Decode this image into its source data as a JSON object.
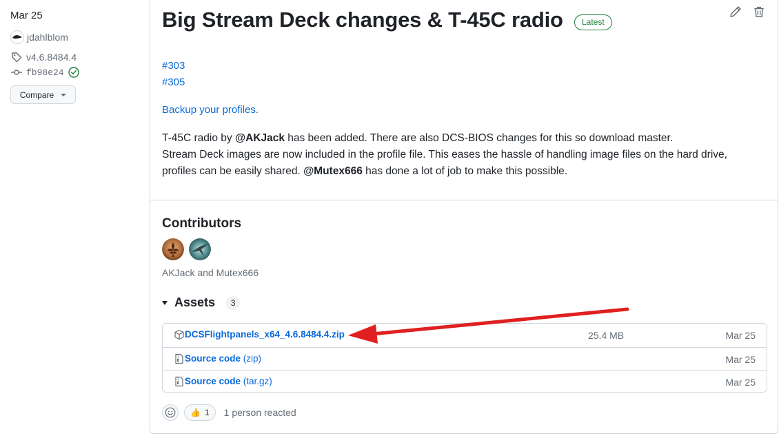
{
  "sidebar": {
    "date": "Mar 25",
    "author": "jdahlblom",
    "tag": "v4.6.8484.4",
    "commit": "fb98e24",
    "compare_label": "Compare"
  },
  "release": {
    "title": "Big Stream Deck changes & T-45C radio",
    "badge": "Latest",
    "issues": [
      "#303",
      "#305"
    ],
    "backup_link": "Backup your profiles.",
    "body": {
      "line1_pre": "T-45C radio by ",
      "line1_mention": "@AKJack",
      "line1_post": " has been added. There are also DCS-BIOS changes for this so download master.",
      "line2": "Stream Deck images are now included in the profile file. This eases the hassle of handling image files on the hard drive,",
      "line3_pre": "profiles can be easily shared. ",
      "line3_mention": "@Mutex666",
      "line3_post": " has done a lot of job to make this possible."
    }
  },
  "contributors": {
    "title": "Contributors",
    "names": "AKJack and Mutex666"
  },
  "assets": {
    "title": "Assets",
    "count": "3",
    "items": [
      {
        "name": "DCSFlightpanels_x64_4.6.8484.4.zip",
        "suffix": "",
        "size": "25.4 MB",
        "date": "Mar 25",
        "icon": "package-icon"
      },
      {
        "name": "Source code",
        "suffix": "(zip)",
        "size": "",
        "date": "Mar 25",
        "icon": "file-zip-icon"
      },
      {
        "name": "Source code",
        "suffix": "(tar.gz)",
        "size": "",
        "date": "Mar 25",
        "icon": "file-zip-icon"
      }
    ]
  },
  "reactions": {
    "emoji": "👍",
    "count": "1",
    "summary": "1 person reacted"
  },
  "colors": {
    "link": "#0969da",
    "latest_green": "#1a7f37",
    "annotation_arrow": "#e02020"
  }
}
